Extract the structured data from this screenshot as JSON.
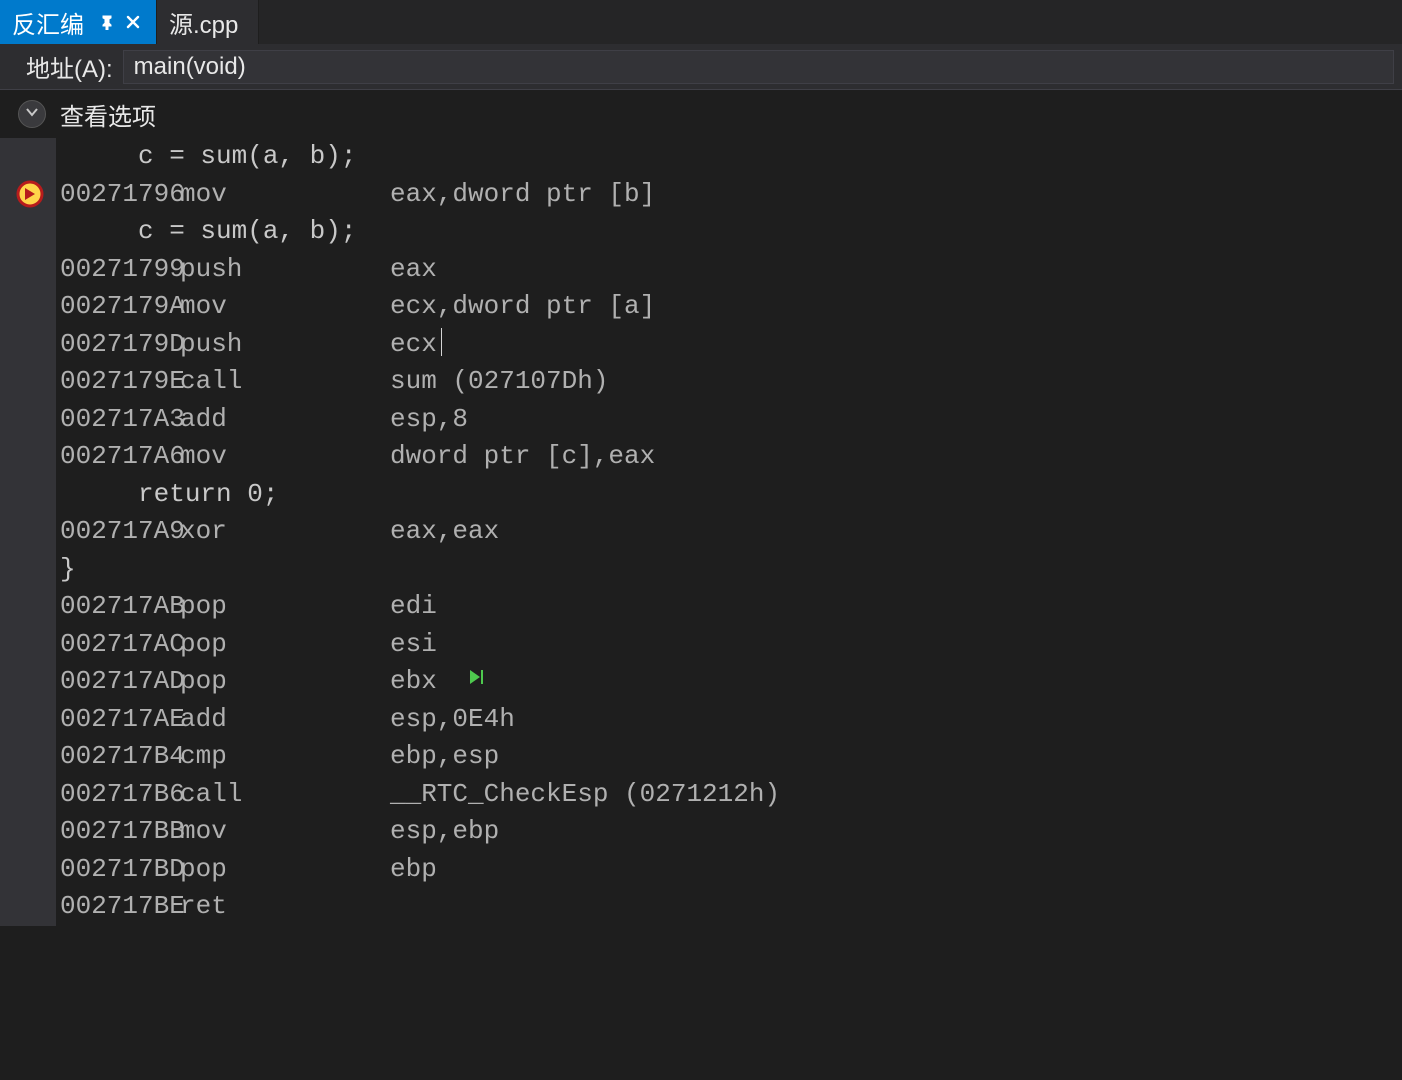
{
  "tabs": {
    "active": {
      "label": "反汇编"
    },
    "inactive": {
      "label": "源.cpp"
    }
  },
  "addressBar": {
    "label": "地址(A):",
    "value": "main(void)"
  },
  "options": {
    "label": "查看选项"
  },
  "code": {
    "lines": [
      {
        "type": "src",
        "indent": "     ",
        "text": "c = sum(a, b);"
      },
      {
        "type": "asm",
        "addr": "00271796",
        "mnem": "mov",
        "ops": "eax,dword ptr [b]",
        "exec": true
      },
      {
        "type": "src",
        "indent": "     ",
        "text": "c = sum(a, b);"
      },
      {
        "type": "asm",
        "addr": "00271799",
        "mnem": "push",
        "ops": "eax"
      },
      {
        "type": "asm",
        "addr": "0027179A",
        "mnem": "mov",
        "ops": "ecx,dword ptr [a]"
      },
      {
        "type": "asm",
        "addr": "0027179D",
        "mnem": "push",
        "ops": "ecx",
        "cursor": true
      },
      {
        "type": "asm",
        "addr": "0027179E",
        "mnem": "call",
        "ops": "sum (027107Dh)"
      },
      {
        "type": "asm",
        "addr": "002717A3",
        "mnem": "add",
        "ops": "esp,8"
      },
      {
        "type": "asm",
        "addr": "002717A6",
        "mnem": "mov",
        "ops": "dword ptr [c],eax"
      },
      {
        "type": "src",
        "indent": "     ",
        "text": "return 0;"
      },
      {
        "type": "asm",
        "addr": "002717A9",
        "mnem": "xor",
        "ops": "eax,eax"
      },
      {
        "type": "brace",
        "text": "}"
      },
      {
        "type": "asm",
        "addr": "002717AB",
        "mnem": "pop",
        "ops": "edi"
      },
      {
        "type": "asm",
        "addr": "002717AC",
        "mnem": "pop",
        "ops": "esi"
      },
      {
        "type": "asm",
        "addr": "002717AD",
        "mnem": "pop",
        "ops": "ebx",
        "play": true
      },
      {
        "type": "asm",
        "addr": "002717AE",
        "mnem": "add",
        "ops": "esp,0E4h"
      },
      {
        "type": "asm",
        "addr": "002717B4",
        "mnem": "cmp",
        "ops": "ebp,esp"
      },
      {
        "type": "asm",
        "addr": "002717B6",
        "mnem": "call",
        "ops": "__RTC_CheckEsp (0271212h)"
      },
      {
        "type": "asm",
        "addr": "002717BB",
        "mnem": "mov",
        "ops": "esp,ebp"
      },
      {
        "type": "asm",
        "addr": "002717BD",
        "mnem": "pop",
        "ops": "ebp"
      },
      {
        "type": "asm",
        "addr": "002717BE",
        "mnem": "ret",
        "ops": ""
      }
    ]
  }
}
